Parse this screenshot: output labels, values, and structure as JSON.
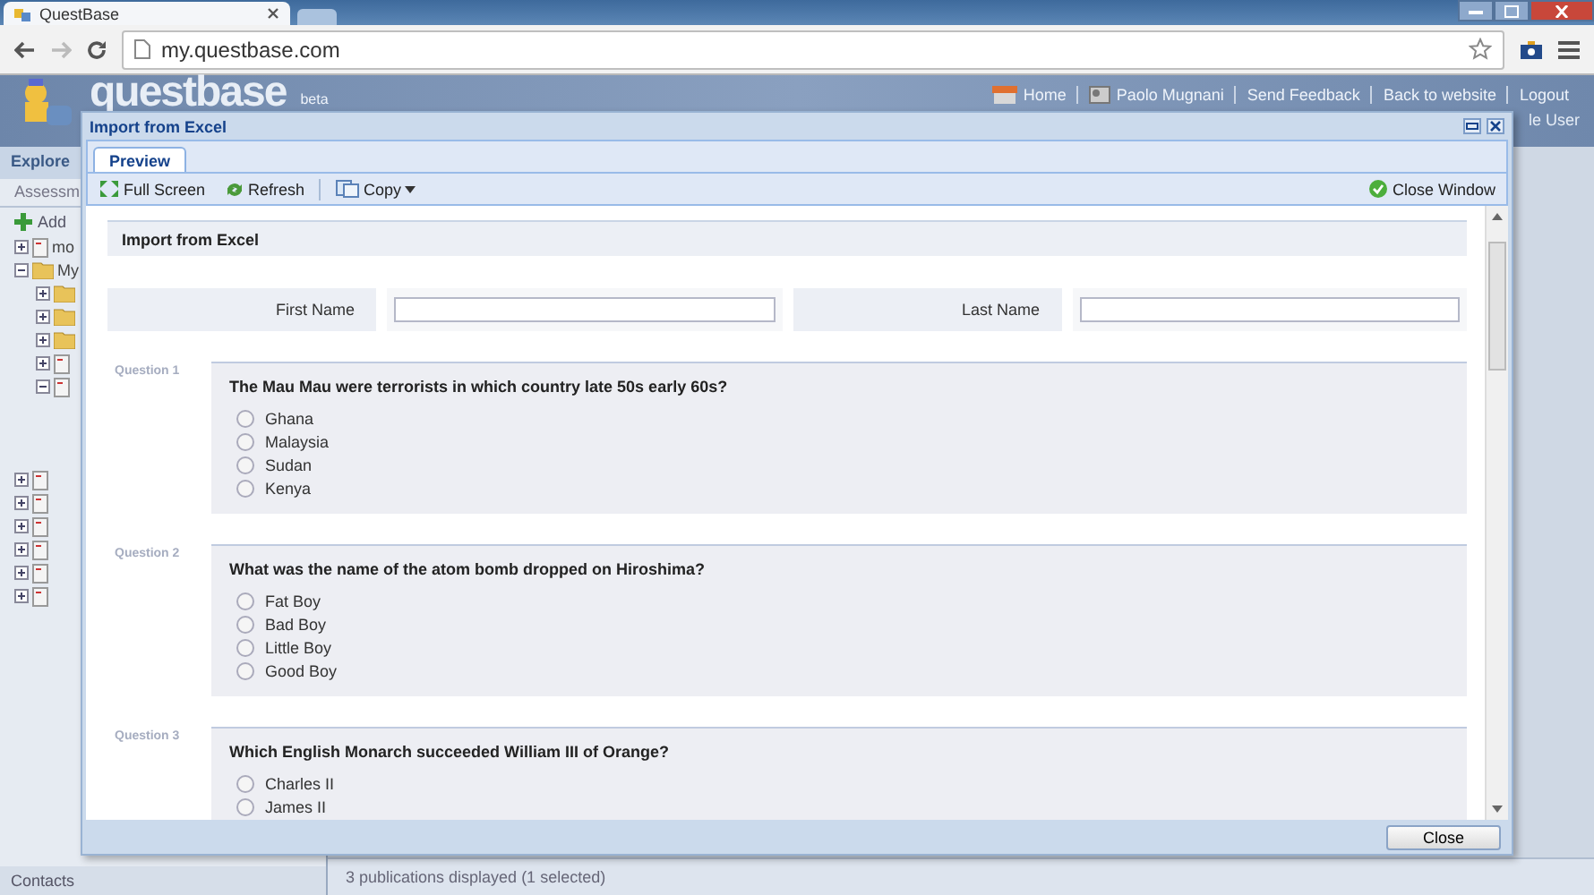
{
  "browser": {
    "tab_title": "QuestBase",
    "url": "my.questbase.com"
  },
  "app": {
    "logo": "questbase",
    "logo_badge": "beta",
    "nav": [
      "Home",
      "Paolo Mugnani",
      "Send Feedback",
      "Back to website",
      "Logout"
    ],
    "user_role": "le User",
    "left_panel": {
      "title": "Explore",
      "tab": "Assessm",
      "add": "Add",
      "tree": [
        {
          "label": "mo",
          "kind": "doc",
          "expanded": false
        },
        {
          "label": "My",
          "kind": "folder",
          "expanded": true,
          "children": [
            {
              "kind": "folder",
              "expanded": false
            },
            {
              "kind": "folder",
              "expanded": false
            },
            {
              "kind": "folder",
              "expanded": false
            },
            {
              "kind": "doc",
              "expanded": false
            },
            {
              "kind": "doc",
              "expanded": true
            }
          ]
        }
      ],
      "tree_lower": [
        {
          "kind": "doc",
          "expanded": false
        },
        {
          "kind": "doc",
          "expanded": false
        },
        {
          "kind": "doc",
          "expanded": false
        },
        {
          "kind": "doc",
          "expanded": false
        },
        {
          "kind": "doc",
          "expanded": false
        },
        {
          "kind": "doc",
          "expanded": false
        }
      ]
    },
    "status": "3 publications displayed (1 selected)",
    "footer": "Contacts"
  },
  "dialog": {
    "title": "Import from Excel",
    "tabs": [
      {
        "label": "Preview",
        "selected": true
      }
    ],
    "toolbar": [
      {
        "label": "Full Screen",
        "kind": "fullscreen",
        "menu": false
      },
      {
        "label": "Refresh",
        "kind": "refresh",
        "menu": false
      },
      {
        "label": "Copy",
        "kind": "copy",
        "menu": true
      }
    ],
    "close_window": "Close Window",
    "form": {
      "heading": "Import from Excel",
      "fields": [
        {
          "label": "First Name"
        },
        {
          "label": "Last Name"
        }
      ],
      "questions": [
        {
          "number": "Question 1",
          "text": "The Mau Mau were terrorists in which country late 50s early 60s?",
          "options": [
            {
              "label": "Ghana",
              "selected": false
            },
            {
              "label": "Malaysia",
              "selected": false
            },
            {
              "label": "Sudan",
              "selected": false
            },
            {
              "label": "Kenya",
              "selected": false
            }
          ]
        },
        {
          "number": "Question 2",
          "text": "What was the name of the atom bomb dropped on Hiroshima?",
          "options": [
            {
              "label": "Fat Boy",
              "selected": false
            },
            {
              "label": "Bad Boy",
              "selected": false
            },
            {
              "label": "Little Boy",
              "selected": false
            },
            {
              "label": "Good Boy",
              "selected": false
            }
          ]
        },
        {
          "number": "Question 3",
          "text": "Which English Monarch succeeded William III of Orange?",
          "options": [
            {
              "label": "Charles II",
              "selected": false
            },
            {
              "label": "James II",
              "selected": false
            }
          ]
        }
      ]
    },
    "footer_button": "Close"
  }
}
